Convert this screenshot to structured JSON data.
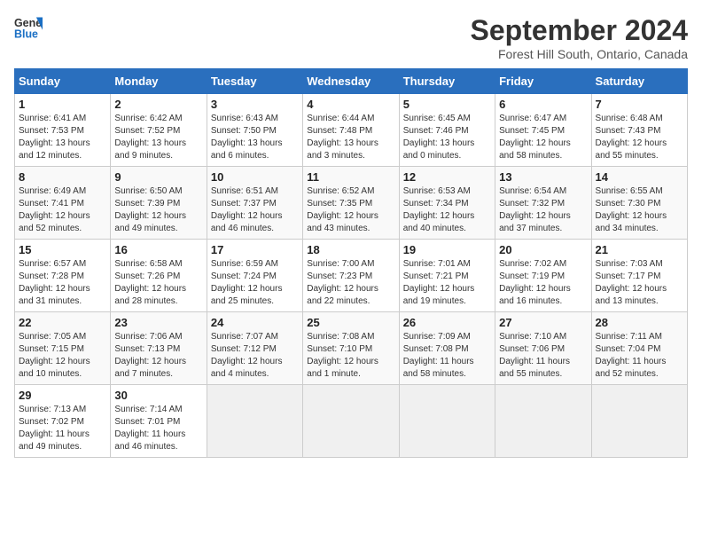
{
  "header": {
    "logo_line1": "General",
    "logo_line2": "Blue",
    "month": "September 2024",
    "location": "Forest Hill South, Ontario, Canada"
  },
  "weekdays": [
    "Sunday",
    "Monday",
    "Tuesday",
    "Wednesday",
    "Thursday",
    "Friday",
    "Saturday"
  ],
  "weeks": [
    [
      {
        "day": "1",
        "info": "Sunrise: 6:41 AM\nSunset: 7:53 PM\nDaylight: 13 hours\nand 12 minutes."
      },
      {
        "day": "2",
        "info": "Sunrise: 6:42 AM\nSunset: 7:52 PM\nDaylight: 13 hours\nand 9 minutes."
      },
      {
        "day": "3",
        "info": "Sunrise: 6:43 AM\nSunset: 7:50 PM\nDaylight: 13 hours\nand 6 minutes."
      },
      {
        "day": "4",
        "info": "Sunrise: 6:44 AM\nSunset: 7:48 PM\nDaylight: 13 hours\nand 3 minutes."
      },
      {
        "day": "5",
        "info": "Sunrise: 6:45 AM\nSunset: 7:46 PM\nDaylight: 13 hours\nand 0 minutes."
      },
      {
        "day": "6",
        "info": "Sunrise: 6:47 AM\nSunset: 7:45 PM\nDaylight: 12 hours\nand 58 minutes."
      },
      {
        "day": "7",
        "info": "Sunrise: 6:48 AM\nSunset: 7:43 PM\nDaylight: 12 hours\nand 55 minutes."
      }
    ],
    [
      {
        "day": "8",
        "info": "Sunrise: 6:49 AM\nSunset: 7:41 PM\nDaylight: 12 hours\nand 52 minutes."
      },
      {
        "day": "9",
        "info": "Sunrise: 6:50 AM\nSunset: 7:39 PM\nDaylight: 12 hours\nand 49 minutes."
      },
      {
        "day": "10",
        "info": "Sunrise: 6:51 AM\nSunset: 7:37 PM\nDaylight: 12 hours\nand 46 minutes."
      },
      {
        "day": "11",
        "info": "Sunrise: 6:52 AM\nSunset: 7:35 PM\nDaylight: 12 hours\nand 43 minutes."
      },
      {
        "day": "12",
        "info": "Sunrise: 6:53 AM\nSunset: 7:34 PM\nDaylight: 12 hours\nand 40 minutes."
      },
      {
        "day": "13",
        "info": "Sunrise: 6:54 AM\nSunset: 7:32 PM\nDaylight: 12 hours\nand 37 minutes."
      },
      {
        "day": "14",
        "info": "Sunrise: 6:55 AM\nSunset: 7:30 PM\nDaylight: 12 hours\nand 34 minutes."
      }
    ],
    [
      {
        "day": "15",
        "info": "Sunrise: 6:57 AM\nSunset: 7:28 PM\nDaylight: 12 hours\nand 31 minutes."
      },
      {
        "day": "16",
        "info": "Sunrise: 6:58 AM\nSunset: 7:26 PM\nDaylight: 12 hours\nand 28 minutes."
      },
      {
        "day": "17",
        "info": "Sunrise: 6:59 AM\nSunset: 7:24 PM\nDaylight: 12 hours\nand 25 minutes."
      },
      {
        "day": "18",
        "info": "Sunrise: 7:00 AM\nSunset: 7:23 PM\nDaylight: 12 hours\nand 22 minutes."
      },
      {
        "day": "19",
        "info": "Sunrise: 7:01 AM\nSunset: 7:21 PM\nDaylight: 12 hours\nand 19 minutes."
      },
      {
        "day": "20",
        "info": "Sunrise: 7:02 AM\nSunset: 7:19 PM\nDaylight: 12 hours\nand 16 minutes."
      },
      {
        "day": "21",
        "info": "Sunrise: 7:03 AM\nSunset: 7:17 PM\nDaylight: 12 hours\nand 13 minutes."
      }
    ],
    [
      {
        "day": "22",
        "info": "Sunrise: 7:05 AM\nSunset: 7:15 PM\nDaylight: 12 hours\nand 10 minutes."
      },
      {
        "day": "23",
        "info": "Sunrise: 7:06 AM\nSunset: 7:13 PM\nDaylight: 12 hours\nand 7 minutes."
      },
      {
        "day": "24",
        "info": "Sunrise: 7:07 AM\nSunset: 7:12 PM\nDaylight: 12 hours\nand 4 minutes."
      },
      {
        "day": "25",
        "info": "Sunrise: 7:08 AM\nSunset: 7:10 PM\nDaylight: 12 hours\nand 1 minute."
      },
      {
        "day": "26",
        "info": "Sunrise: 7:09 AM\nSunset: 7:08 PM\nDaylight: 11 hours\nand 58 minutes."
      },
      {
        "day": "27",
        "info": "Sunrise: 7:10 AM\nSunset: 7:06 PM\nDaylight: 11 hours\nand 55 minutes."
      },
      {
        "day": "28",
        "info": "Sunrise: 7:11 AM\nSunset: 7:04 PM\nDaylight: 11 hours\nand 52 minutes."
      }
    ],
    [
      {
        "day": "29",
        "info": "Sunrise: 7:13 AM\nSunset: 7:02 PM\nDaylight: 11 hours\nand 49 minutes."
      },
      {
        "day": "30",
        "info": "Sunrise: 7:14 AM\nSunset: 7:01 PM\nDaylight: 11 hours\nand 46 minutes."
      },
      null,
      null,
      null,
      null,
      null
    ]
  ]
}
